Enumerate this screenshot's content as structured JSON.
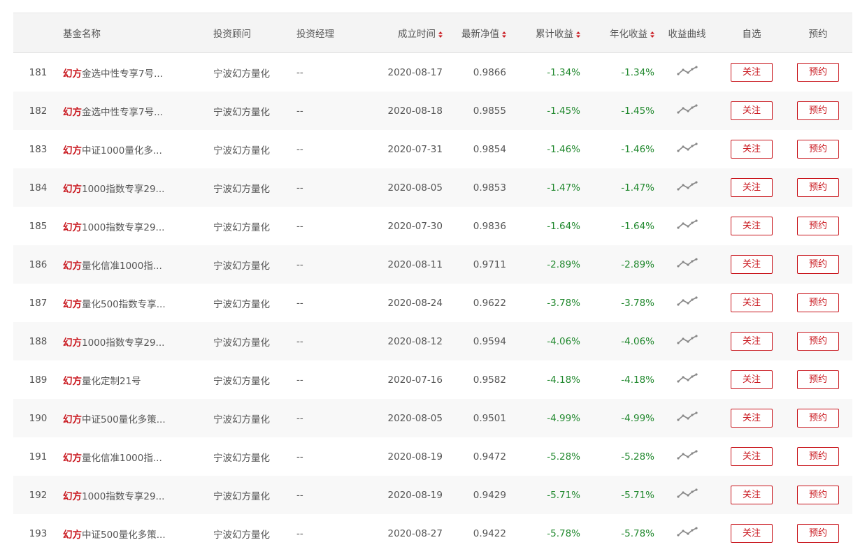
{
  "colors": {
    "brand_red": "#c9171e",
    "negative_green": "#22892f",
    "header_bg": "#f4f4f4",
    "row_alt_bg": "#f8f8f8"
  },
  "header": {
    "fund_name": "基金名称",
    "advisor": "投资顾问",
    "manager": "投资经理",
    "founded": "成立时间",
    "nav": "最新净值",
    "cum_return": "累计收益",
    "ann_return": "年化收益",
    "curve": "收益曲线",
    "watch": "自选",
    "reserve": "预约"
  },
  "icons": {
    "sort": "sort-updown-icon",
    "curve": "line-chart-icon"
  },
  "rows": [
    {
      "idx": "181",
      "brand": "幻方",
      "name": "金选中性专享7号...",
      "advisor": "宁波幻方量化",
      "manager": "--",
      "date": "2020-08-17",
      "nav": "0.9866",
      "cum": "-1.34%",
      "ann": "-1.34%",
      "watch": "关注",
      "reserve": "预约"
    },
    {
      "idx": "182",
      "brand": "幻方",
      "name": "金选中性专享7号...",
      "advisor": "宁波幻方量化",
      "manager": "--",
      "date": "2020-08-18",
      "nav": "0.9855",
      "cum": "-1.45%",
      "ann": "-1.45%",
      "watch": "关注",
      "reserve": "预约"
    },
    {
      "idx": "183",
      "brand": "幻方",
      "name": "中证1000量化多...",
      "advisor": "宁波幻方量化",
      "manager": "--",
      "date": "2020-07-31",
      "nav": "0.9854",
      "cum": "-1.46%",
      "ann": "-1.46%",
      "watch": "关注",
      "reserve": "预约"
    },
    {
      "idx": "184",
      "brand": "幻方",
      "name": "1000指数专享29...",
      "advisor": "宁波幻方量化",
      "manager": "--",
      "date": "2020-08-05",
      "nav": "0.9853",
      "cum": "-1.47%",
      "ann": "-1.47%",
      "watch": "关注",
      "reserve": "预约"
    },
    {
      "idx": "185",
      "brand": "幻方",
      "name": "1000指数专享29...",
      "advisor": "宁波幻方量化",
      "manager": "--",
      "date": "2020-07-30",
      "nav": "0.9836",
      "cum": "-1.64%",
      "ann": "-1.64%",
      "watch": "关注",
      "reserve": "预约"
    },
    {
      "idx": "186",
      "brand": "幻方",
      "name": "量化信准1000指...",
      "advisor": "宁波幻方量化",
      "manager": "--",
      "date": "2020-08-11",
      "nav": "0.9711",
      "cum": "-2.89%",
      "ann": "-2.89%",
      "watch": "关注",
      "reserve": "预约"
    },
    {
      "idx": "187",
      "brand": "幻方",
      "name": "量化500指数专享...",
      "advisor": "宁波幻方量化",
      "manager": "--",
      "date": "2020-08-24",
      "nav": "0.9622",
      "cum": "-3.78%",
      "ann": "-3.78%",
      "watch": "关注",
      "reserve": "预约"
    },
    {
      "idx": "188",
      "brand": "幻方",
      "name": "1000指数专享29...",
      "advisor": "宁波幻方量化",
      "manager": "--",
      "date": "2020-08-12",
      "nav": "0.9594",
      "cum": "-4.06%",
      "ann": "-4.06%",
      "watch": "关注",
      "reserve": "预约"
    },
    {
      "idx": "189",
      "brand": "幻方",
      "name": "量化定制21号",
      "advisor": "宁波幻方量化",
      "manager": "--",
      "date": "2020-07-16",
      "nav": "0.9582",
      "cum": "-4.18%",
      "ann": "-4.18%",
      "watch": "关注",
      "reserve": "预约"
    },
    {
      "idx": "190",
      "brand": "幻方",
      "name": "中证500量化多策...",
      "advisor": "宁波幻方量化",
      "manager": "--",
      "date": "2020-08-05",
      "nav": "0.9501",
      "cum": "-4.99%",
      "ann": "-4.99%",
      "watch": "关注",
      "reserve": "预约"
    },
    {
      "idx": "191",
      "brand": "幻方",
      "name": "量化信准1000指...",
      "advisor": "宁波幻方量化",
      "manager": "--",
      "date": "2020-08-19",
      "nav": "0.9472",
      "cum": "-5.28%",
      "ann": "-5.28%",
      "watch": "关注",
      "reserve": "预约"
    },
    {
      "idx": "192",
      "brand": "幻方",
      "name": "1000指数专享29...",
      "advisor": "宁波幻方量化",
      "manager": "--",
      "date": "2020-08-19",
      "nav": "0.9429",
      "cum": "-5.71%",
      "ann": "-5.71%",
      "watch": "关注",
      "reserve": "预约"
    },
    {
      "idx": "193",
      "brand": "幻方",
      "name": "中证500量化多策...",
      "advisor": "宁波幻方量化",
      "manager": "--",
      "date": "2020-08-27",
      "nav": "0.9422",
      "cum": "-5.78%",
      "ann": "-5.78%",
      "watch": "关注",
      "reserve": "预约"
    }
  ]
}
